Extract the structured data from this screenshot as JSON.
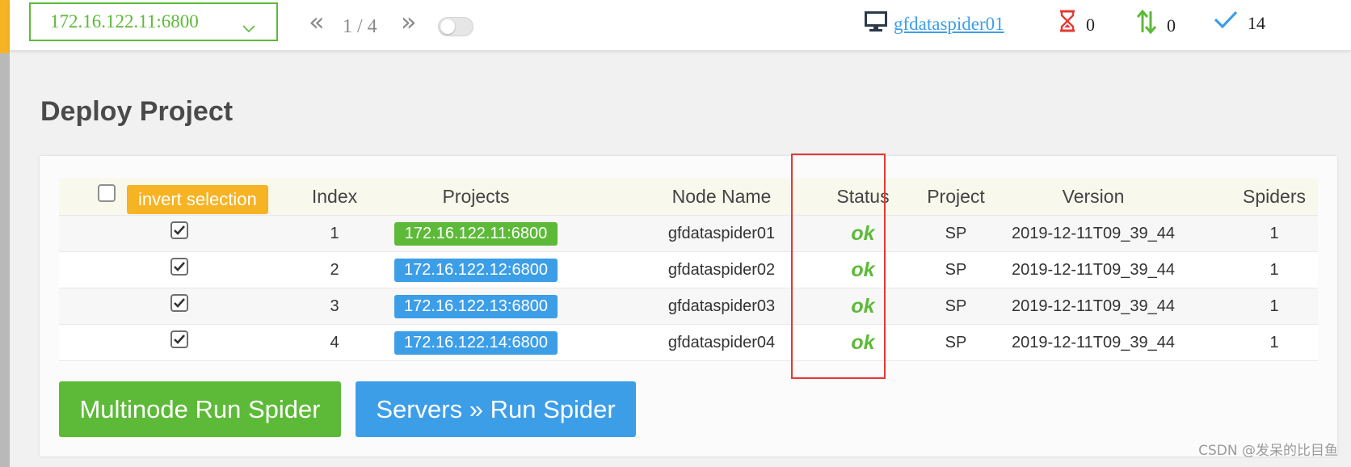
{
  "topbar": {
    "selected_node": "172.16.122.11:6800",
    "pager": {
      "prev": "«",
      "text": "1 / 4",
      "next": "»"
    },
    "hostname": "gfdataspider01",
    "stats": {
      "pending": "0",
      "running": "0",
      "finished": "14"
    }
  },
  "page": {
    "title": "Deploy Project"
  },
  "table": {
    "invert_selection_label": "invert selection",
    "headers": {
      "index": "Index",
      "projects": "Projects",
      "node_name": "Node Name",
      "status": "Status",
      "project": "Project",
      "version": "Version",
      "spiders": "Spiders"
    },
    "rows": [
      {
        "index": "1",
        "server": "172.16.122.11:6800",
        "node": "gfdataspider01",
        "status": "ok",
        "project": "SP",
        "version": "2019-12-11T09_39_44",
        "spiders": "1"
      },
      {
        "index": "2",
        "server": "172.16.122.12:6800",
        "node": "gfdataspider02",
        "status": "ok",
        "project": "SP",
        "version": "2019-12-11T09_39_44",
        "spiders": "1"
      },
      {
        "index": "3",
        "server": "172.16.122.13:6800",
        "node": "gfdataspider03",
        "status": "ok",
        "project": "SP",
        "version": "2019-12-11T09_39_44",
        "spiders": "1"
      },
      {
        "index": "4",
        "server": "172.16.122.14:6800",
        "node": "gfdataspider04",
        "status": "ok",
        "project": "SP",
        "version": "2019-12-11T09_39_44",
        "spiders": "1"
      }
    ]
  },
  "actions": {
    "multinode_run": "Multinode Run Spider",
    "servers_run": "Servers » Run Spider"
  },
  "watermark": "CSDN @发呆的比目鱼",
  "colors": {
    "green": "#5dba38",
    "blue": "#3d9ee8",
    "orange": "#f6b324",
    "red": "#e53935"
  }
}
